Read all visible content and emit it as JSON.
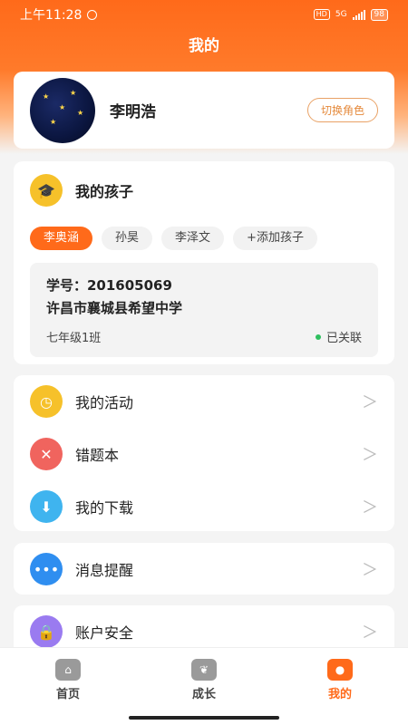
{
  "status": {
    "time": "上午11:28",
    "network": "5G",
    "hd": "HD",
    "battery": "98"
  },
  "header": {
    "title": "我的"
  },
  "profile": {
    "name": "李明浩",
    "switch_role_label": "切换角色"
  },
  "children": {
    "title": "我的孩子",
    "tabs": [
      "李奥涵",
      "孙昊",
      "李泽文",
      "+添加孩子"
    ],
    "active_tab": "李奥涵",
    "student_id_label": "学号：201605069",
    "school": "许昌市襄城县希望中学",
    "class": "七年级1班",
    "link_status": "已关联"
  },
  "menu": {
    "activities": "我的活动",
    "wrong_questions": "错题本",
    "downloads": "我的下载",
    "notifications": "消息提醒",
    "account_security": "账户安全"
  },
  "tabbar": {
    "home": "首页",
    "growth": "成长",
    "mine": "我的"
  },
  "colors": {
    "accent": "#ff6a1a",
    "linked_dot": "#2fbf5f"
  }
}
